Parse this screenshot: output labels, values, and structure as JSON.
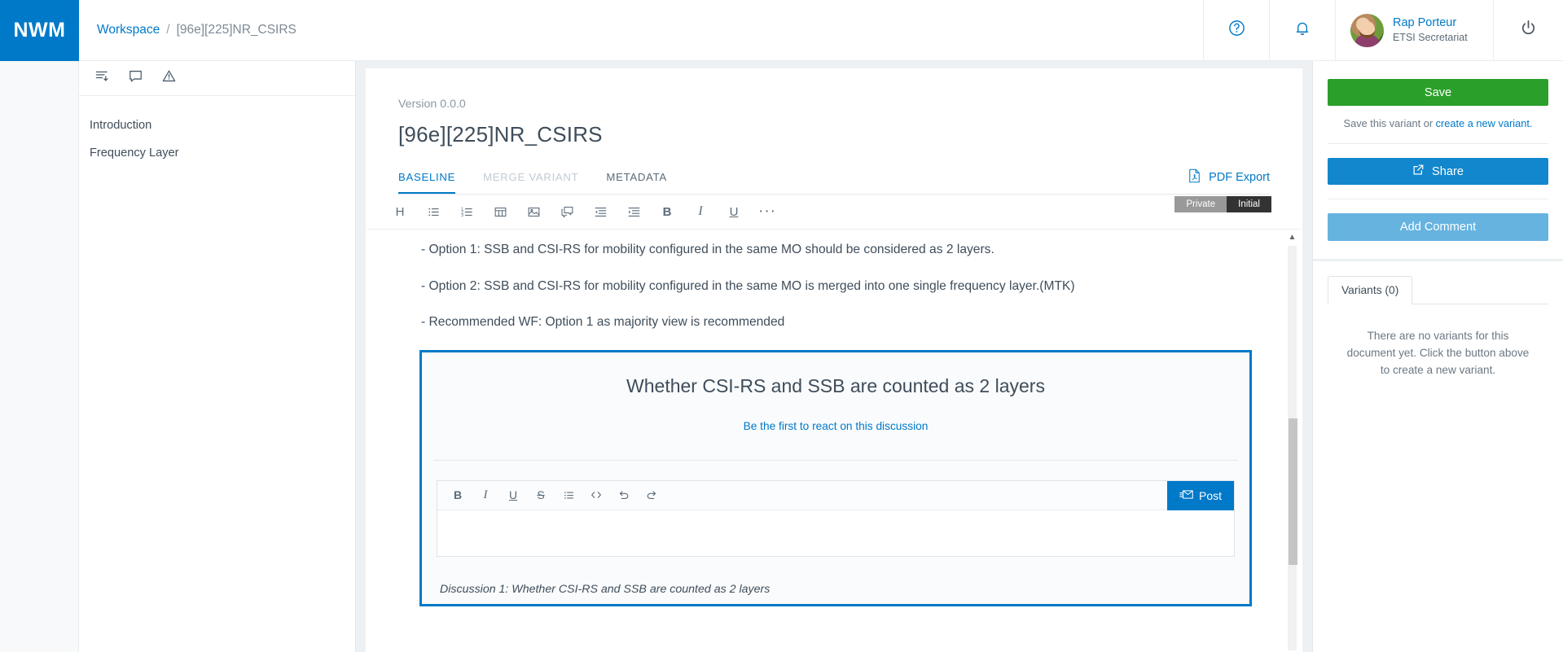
{
  "brand": {
    "logo": "NWM"
  },
  "breadcrumb": {
    "root": "Workspace",
    "separator": "/",
    "current": "[96e][225]NR_CSIRS"
  },
  "user": {
    "name": "Rap Porteur",
    "role": "ETSI Secretariat"
  },
  "topbar_icons": {
    "help": "help-icon",
    "notifications": "bell-icon",
    "logout": "power-icon"
  },
  "sidebar": {
    "tools": [
      "outline-icon",
      "comment-icon",
      "warning-icon"
    ],
    "items": [
      {
        "label": "Introduction"
      },
      {
        "label": "Frequency Layer"
      }
    ]
  },
  "document": {
    "version": "Version 0.0.0",
    "title": "[96e][225]NR_CSIRS",
    "badges": {
      "visibility": "Private",
      "state": "Initial"
    },
    "tabs": [
      {
        "label": "BASELINE",
        "state": "active"
      },
      {
        "label": "MERGE VARIANT",
        "state": "disabled"
      },
      {
        "label": "METADATA",
        "state": "normal"
      }
    ],
    "pdf_export": "PDF Export",
    "toolbar": [
      "heading-icon",
      "bullet-list-icon",
      "numbered-list-icon",
      "table-icon",
      "image-icon",
      "comment-icon",
      "outdent-icon",
      "indent-icon",
      "bold-icon",
      "italic-icon",
      "underline-icon",
      "more-icon"
    ],
    "paragraphs": [
      "- Option 1: SSB and CSI-RS for mobility configured in the same MO should be considered as 2 layers.",
      "- Option 2: SSB and CSI-RS for mobility configured in the same MO is merged into one single frequency layer.(MTK)",
      "- Recommended WF: Option 1 as majority view is recommended"
    ]
  },
  "discussion": {
    "title": "Whether CSI-RS and SSB are counted as 2 layers",
    "react_link": "Be the first to react on this discussion",
    "comment_toolbar": [
      "bold-icon",
      "italic-icon",
      "underline-icon",
      "strikethrough-icon",
      "bullet-list-icon",
      "code-icon",
      "undo-icon",
      "redo-icon"
    ],
    "post_button": "Post",
    "comment_placeholder": "",
    "footer_note": "Discussion 1: Whether CSI-RS and SSB are counted as 2 layers"
  },
  "right_panel": {
    "save_button": "Save",
    "save_note_prefix": "Save this variant or ",
    "save_note_link": "create a new variant.",
    "share_button": "Share",
    "add_comment_button": "Add Comment",
    "variants_tab": "Variants (0)",
    "variants_empty": "There are no variants for this document yet. Click the button above to create a new variant."
  },
  "colors": {
    "brand_blue": "#0079c8",
    "save_green": "#2aa02a",
    "share_blue": "#1287cd",
    "comment_blue": "#66b3e0",
    "badge_private": "#999999",
    "badge_initial": "#333333"
  }
}
